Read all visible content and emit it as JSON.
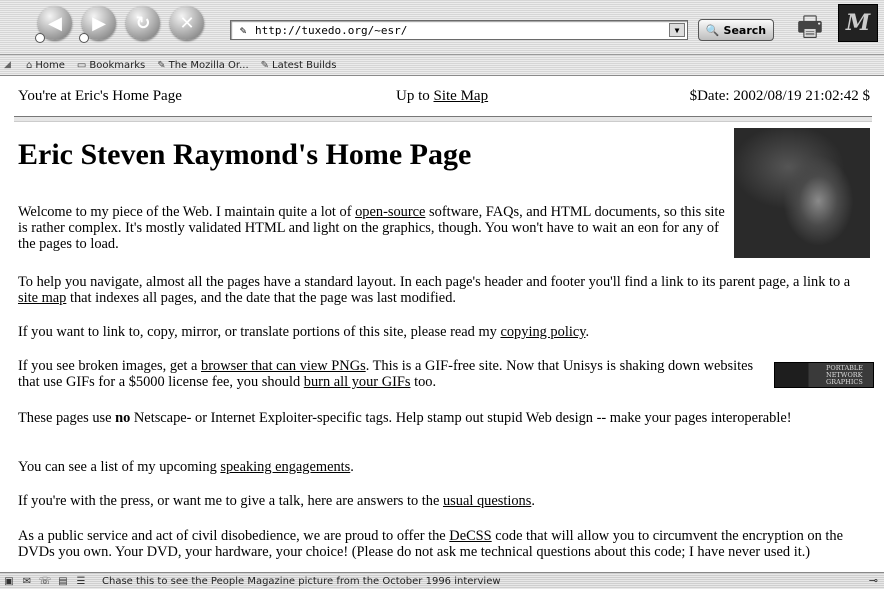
{
  "browser": {
    "url": "http://tuxedo.org/~esr/",
    "search_label": "Search",
    "nav_icons": [
      "back-icon",
      "forward-icon",
      "reload-icon",
      "stop-icon"
    ],
    "personal_toolbar": [
      {
        "label": "Home",
        "icon": "home-icon"
      },
      {
        "label": "Bookmarks",
        "icon": "folder-icon"
      },
      {
        "label": "The Mozilla Or...",
        "icon": "bookmark-icon"
      },
      {
        "label": "Latest Builds",
        "icon": "bookmark-icon"
      }
    ],
    "status_text": "Chase this to see the People Magazine picture from the October 1996 interview"
  },
  "page": {
    "header": {
      "location": "You're at Eric's Home Page",
      "up_prefix": "Up to ",
      "up_link": "Site Map",
      "date": "$Date: 2002/08/19 21:02:42 $"
    },
    "title": "Eric Steven Raymond's Home Page",
    "p1": {
      "a": "Welcome to my piece of the Web. I maintain quite a lot of ",
      "link": "open-source",
      "b": " software, FAQs, and HTML documents, so this site is rather complex. It's mostly validated HTML and light on the graphics, though. You won't have to wait an eon for any of the pages to load."
    },
    "p2": {
      "a": "To help you navigate, almost all the pages have a standard layout. In each page's header and footer you'll find a link to its parent page, a link to a ",
      "link": "site map",
      "b": " that indexes all pages, and the date that the page was last modified."
    },
    "p3": {
      "a": "If you want to link to, copy, mirror, or translate portions of this site, please read my ",
      "link": "copying policy",
      "b": "."
    },
    "p4": {
      "a": "If you see broken images, get a ",
      "link1": "browser that can view PNGs",
      "b": ". This is a GIF-free site. Now that Unisys is shaking down websites that use GIFs for a $5000 license fee, you should ",
      "link2": "burn all your GIFs",
      "c": " too."
    },
    "png_badge": [
      "PORTABLE",
      "NETWORK",
      "GRAPHICS"
    ],
    "p5": {
      "a": "These pages use ",
      "bold": "no",
      "b": " Netscape- or Internet Exploiter-specific tags. Help stamp out stupid Web design -- make your pages interoperable!"
    },
    "p6": {
      "a": "You can see a list of my upcoming ",
      "link": "speaking engagements",
      "b": "."
    },
    "p7": {
      "a": "If you're with the press, or want me to give a talk, here are answers to the ",
      "link": "usual questions",
      "b": "."
    },
    "p8": {
      "a": "As a public service and act of civil disobedience, we are proud to offer the ",
      "link": "DeCSS",
      "b": " code that will allow you to circumvent the encryption on the DVDs you own. Your DVD, your hardware, your choice! (Please do not ask me technical questions about this code; I have never used it.)"
    }
  }
}
